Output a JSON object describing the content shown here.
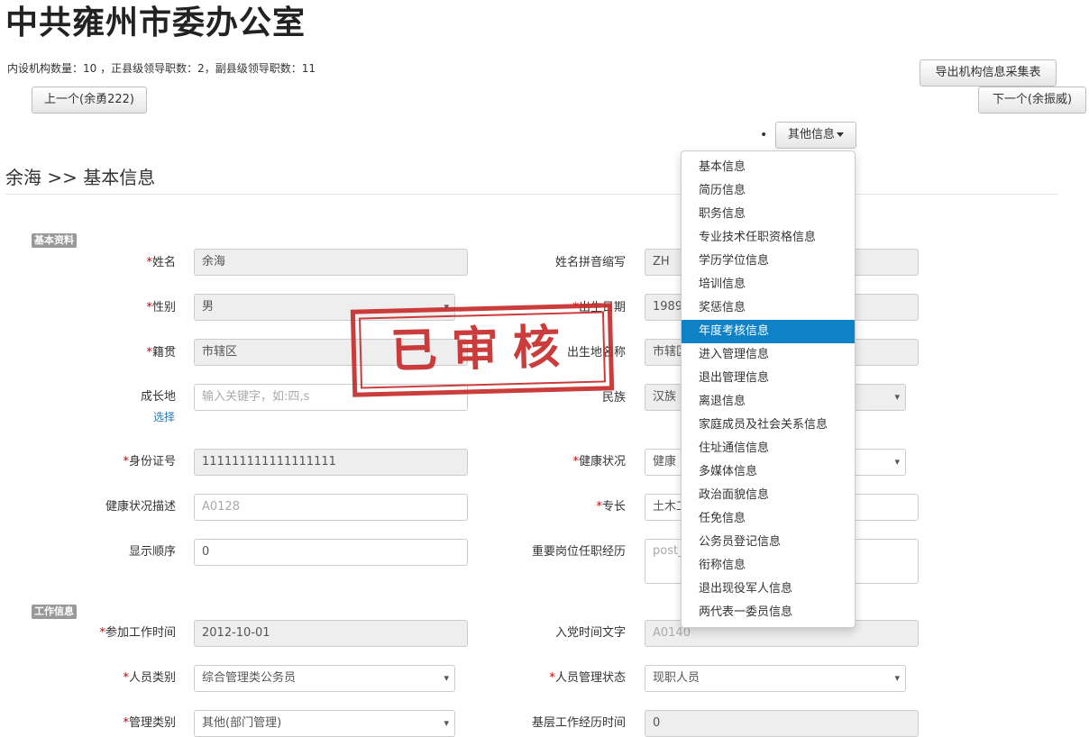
{
  "header": {
    "title": "中共雍州市委办公室",
    "stats": "内设机构数量：10 ，正县级领导职数：2，副县级领导职数：11"
  },
  "toolbar": {
    "export_label": "导出机构信息采集表",
    "prev_label": "上一个(余勇222)",
    "next_label": "下一个(余振威)",
    "other_info_label": "其他信息"
  },
  "breadcrumb": "余海 >> 基本信息",
  "sections": {
    "basic": "基本资料",
    "work": "工作信息"
  },
  "stamp_text": "已审核",
  "form": {
    "name": {
      "label": "姓名",
      "value": "余海"
    },
    "pinyin": {
      "label": "姓名拼音缩写",
      "value": "ZH"
    },
    "gender": {
      "label": "性别",
      "value": "男"
    },
    "birth": {
      "label": "出生日期",
      "value": "1989-"
    },
    "native": {
      "label": "籍贯",
      "value": "市辖区"
    },
    "birthplace": {
      "label": "出生地名称",
      "value": "市辖区"
    },
    "growth": {
      "label": "成长地",
      "placeholder": "输入关键字，如:四,s",
      "select_link": "选择"
    },
    "ethnic": {
      "label": "民族",
      "value": "汉族"
    },
    "idcard": {
      "label": "身份证号",
      "value": "111111111111111111"
    },
    "health": {
      "label": "健康状况",
      "value": "健康"
    },
    "health_desc": {
      "label": "健康状况描述",
      "placeholder": "A0128"
    },
    "specialty": {
      "label": "专长",
      "value": "土木工"
    },
    "order": {
      "label": "显示顺序",
      "value": "0"
    },
    "post_exp": {
      "label": "重要岗位任职经历",
      "placeholder": "post_"
    },
    "work_start": {
      "label": "参加工作时间",
      "value": "2012-10-01"
    },
    "party_text": {
      "label": "入党时间文字",
      "placeholder": "A0140"
    },
    "person_type": {
      "label": "人员类别",
      "value": "综合管理类公务员"
    },
    "person_status": {
      "label": "人员管理状态",
      "value": "现职人员"
    },
    "manage_type": {
      "label": "管理类别",
      "value": "其他(部门管理)"
    },
    "grassroots": {
      "label": "基层工作经历时间",
      "value": "0"
    }
  },
  "dropdown": {
    "items": [
      "基本信息",
      "简历信息",
      "职务信息",
      "专业技术任职资格信息",
      "学历学位信息",
      "培训信息",
      "奖惩信息",
      "年度考核信息",
      "进入管理信息",
      "退出管理信息",
      "离退信息",
      "家庭成员及社会关系信息",
      "住址通信信息",
      "多媒体信息",
      "政治面貌信息",
      "任免信息",
      "公务员登记信息",
      "衔称信息",
      "退出现役军人信息",
      "两代表一委员信息"
    ],
    "active": "年度考核信息"
  },
  "colors": {
    "menu_active": "#0f81c6",
    "required": "#cc0000",
    "stamp": "#c72d2d",
    "link": "#2a7ab8"
  }
}
